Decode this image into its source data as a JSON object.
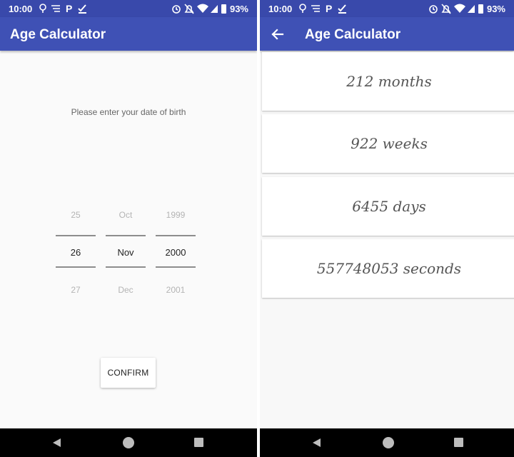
{
  "status_bar": {
    "time": "10:00",
    "battery": "93%"
  },
  "left_screen": {
    "app_title": "Age Calculator",
    "prompt": "Please enter your date of birth",
    "picker": {
      "day": {
        "prev": "25",
        "selected": "26",
        "next": "27"
      },
      "month": {
        "prev": "Oct",
        "selected": "Nov",
        "next": "Dec"
      },
      "year": {
        "prev": "1999",
        "selected": "2000",
        "next": "2001"
      }
    },
    "confirm_label": "CONFIRM"
  },
  "right_screen": {
    "app_title": "Age Calculator",
    "results": [
      "212 months",
      "922 weeks",
      "6455 days",
      "557748053 seconds"
    ]
  },
  "colors": {
    "status_bar": "#3949ab",
    "app_bar": "#3f51b5",
    "nav_bar": "#000000"
  },
  "icons": {
    "status_left": [
      "lightbulb-icon",
      "signal-icon",
      "parking-icon",
      "checkmark-icon"
    ],
    "status_right": [
      "alarm-icon",
      "notifications-off-icon",
      "wifi-icon",
      "cell-signal-icon",
      "battery-icon"
    ],
    "nav": [
      "back-triangle-icon",
      "home-circle-icon",
      "recents-square-icon"
    ]
  }
}
